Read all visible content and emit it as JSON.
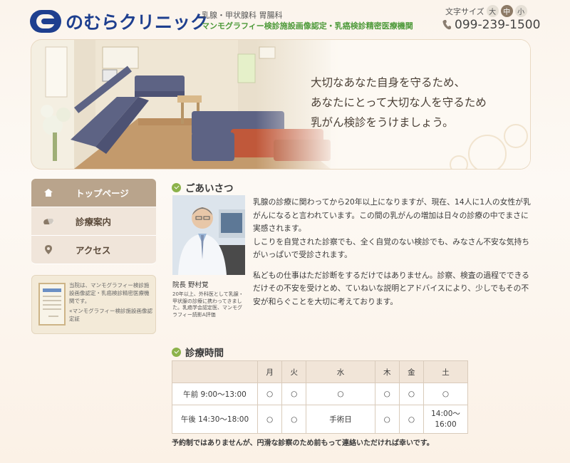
{
  "header": {
    "logo_text": "のむらクリニック",
    "departments": "乳腺・甲状腺科 胃腸科",
    "certification": "マンモグラフィー検診施設画像認定・乳癌検診精密医療機関",
    "font_size_label": "文字サイズ",
    "font_sizes": [
      "大",
      "中",
      "小"
    ],
    "font_size_selected": "中",
    "phone": "099-239-1500"
  },
  "hero": {
    "lines": [
      "大切なあなた自身を守るため、",
      "あなたにとって大切な人を守るため",
      "乳がん検診をうけましょう。"
    ]
  },
  "nav": {
    "items": [
      {
        "label": "トップページ",
        "icon": "home-icon"
      },
      {
        "label": "診療案内",
        "icon": "pill-icon"
      },
      {
        "label": "アクセス",
        "icon": "map-pin-icon"
      }
    ]
  },
  "cert_box": {
    "text": "当院は、マンモグラフィー検診施設画像認定・乳癌検診精密医療機関です。",
    "caption": "«マンモグラフィー検診施設画像認定証"
  },
  "greeting": {
    "title": "ごあいさつ",
    "doctor_caption": "院長 野村覚",
    "doctor_bio": "20年以上、外科医として乳腺・甲状腺の診療に携わってきました。乳癌学会認定医、マンモグラフィー読影A評価",
    "paragraph1_line1": "乳腺の診療に関わってから20年以上になりますが、現在、14人に1人の女性が乳がんになると言われています。この間の乳がんの増加は日々の診療の中でまさに実感されます。",
    "paragraph1_line2": "しこりを自覚された診察でも、全く自覚のない検診でも、みなさん不安な気持ちがいっぱいで受診されます。",
    "paragraph2": "私どもの仕事はただ診断をするだけではありません。診察、検査の過程でできるだけその不安を受けとめ、ていねいな説明とアドバイスにより、少しでもその不安が和らぐことを大切に考えております。"
  },
  "hours": {
    "title": "診療時間",
    "days": [
      "月",
      "火",
      "水",
      "木",
      "金",
      "土"
    ],
    "rows": [
      {
        "label": "午前 9:00〜13:00",
        "cells": [
          "○",
          "○",
          "○",
          "○",
          "○",
          "○"
        ]
      },
      {
        "label": "午後 14:30〜18:00",
        "cells": [
          "○",
          "○",
          "手術日",
          "○",
          "○",
          "14:00〜16:00"
        ]
      }
    ],
    "note": "予約制ではありませんが、円滑な診察のため前もって連絡いただければ幸いです。"
  },
  "colors": {
    "brand_blue": "#1e3f8f",
    "accent_green": "#4e9a3a",
    "nav_active": "#b9a48c",
    "nav_bg": "#f0e5da"
  }
}
